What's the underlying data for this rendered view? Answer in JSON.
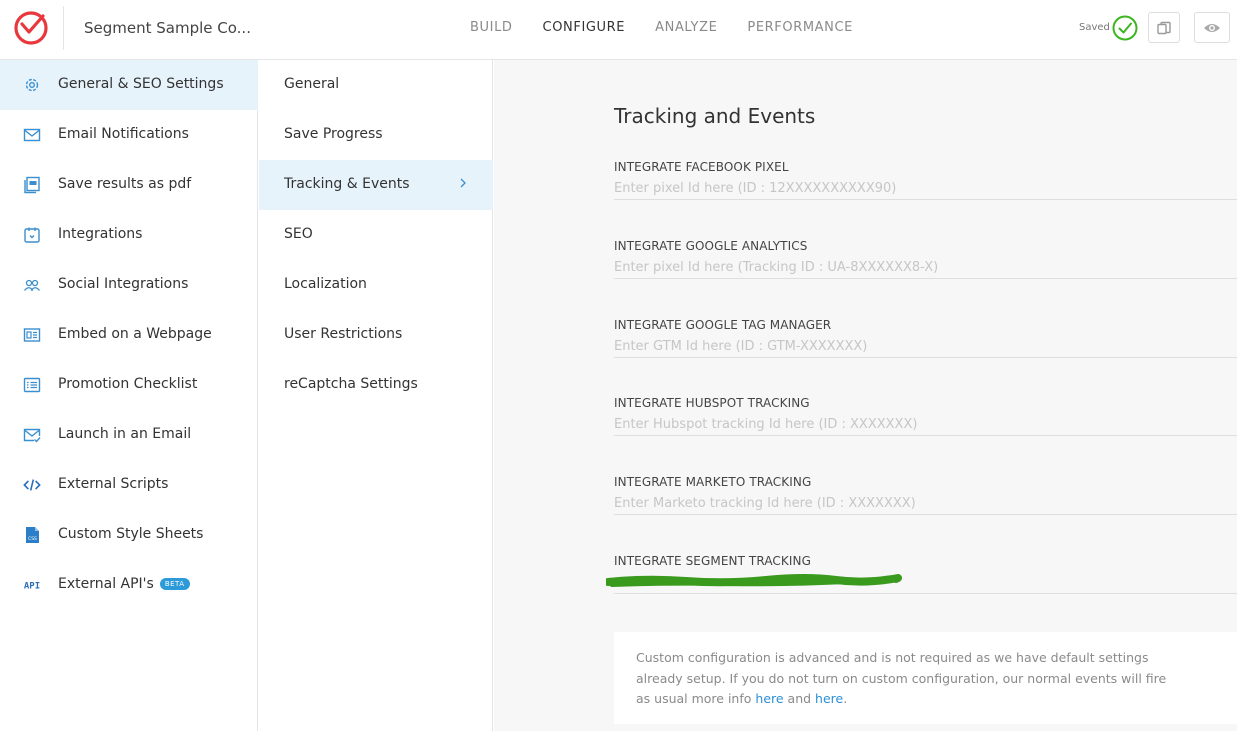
{
  "header": {
    "project_title": "Segment Sample Co...",
    "tabs": [
      {
        "label": "BUILD"
      },
      {
        "label": "CONFIGURE"
      },
      {
        "label": "ANALYZE"
      },
      {
        "label": "PERFORMANCE"
      }
    ],
    "active_tab": "CONFIGURE",
    "saved_label": "Saved"
  },
  "sidebar": {
    "items": [
      {
        "label": "General & SEO Settings",
        "icon": "gear-icon"
      },
      {
        "label": "Email Notifications",
        "icon": "envelope-icon"
      },
      {
        "label": "Save results as pdf",
        "icon": "pdf-icon"
      },
      {
        "label": "Integrations",
        "icon": "integrations-icon"
      },
      {
        "label": "Social Integrations",
        "icon": "people-icon"
      },
      {
        "label": "Embed on a Webpage",
        "icon": "embed-icon"
      },
      {
        "label": "Promotion Checklist",
        "icon": "checklist-icon"
      },
      {
        "label": "Launch in an Email",
        "icon": "email-check-icon"
      },
      {
        "label": " External Scripts",
        "icon": "code-icon"
      },
      {
        "label": "Custom Style Sheets",
        "icon": "css-file-icon"
      },
      {
        "label": "External API's",
        "icon": "api-icon",
        "badge": "BETA"
      }
    ]
  },
  "subnav": {
    "items": [
      {
        "label": "General"
      },
      {
        "label": "Save Progress"
      },
      {
        "label": "Tracking & Events"
      },
      {
        "label": "SEO"
      },
      {
        "label": "Localization"
      },
      {
        "label": "User Restrictions"
      },
      {
        "label": "reCaptcha Settings"
      }
    ],
    "active_index": 2
  },
  "main": {
    "title": "Tracking and Events",
    "fields": [
      {
        "label": "INTEGRATE FACEBOOK PIXEL",
        "placeholder": "Enter pixel Id here (ID : 12XXXXXXXXXX90)",
        "value": ""
      },
      {
        "label": "INTEGRATE GOOGLE ANALYTICS",
        "placeholder": "Enter pixel Id here (Tracking ID : UA-8XXXXXX8-X)",
        "value": ""
      },
      {
        "label": "INTEGRATE GOOGLE TAG MANAGER",
        "placeholder": "Enter GTM Id here (ID : GTM-XXXXXXX)",
        "value": ""
      },
      {
        "label": "INTEGRATE HUBSPOT TRACKING",
        "placeholder": "Enter Hubspot tracking Id here (ID : XXXXXXX)",
        "value": ""
      },
      {
        "label": "INTEGRATE MARKETO TRACKING",
        "placeholder": "Enter Marketo tracking Id here (ID : XXXXXXX)",
        "value": ""
      },
      {
        "label": "INTEGRATE SEGMENT TRACKING",
        "placeholder": "",
        "value": "",
        "redacted": true
      }
    ],
    "info": {
      "text_before": "Custom configuration is advanced and is not required as we have default settings already setup. If you do not turn on custom configuration, our normal events will fire as usual more info ",
      "link1": "here",
      "text_mid": " and ",
      "link2": "here",
      "text_after": "."
    }
  },
  "colors": {
    "accent_blue": "#2d9ad9",
    "active_bg": "#e7f3fb",
    "logo_red": "#e8383d",
    "saved_green": "#3cb521",
    "redaction_green": "#3a9a1e"
  }
}
